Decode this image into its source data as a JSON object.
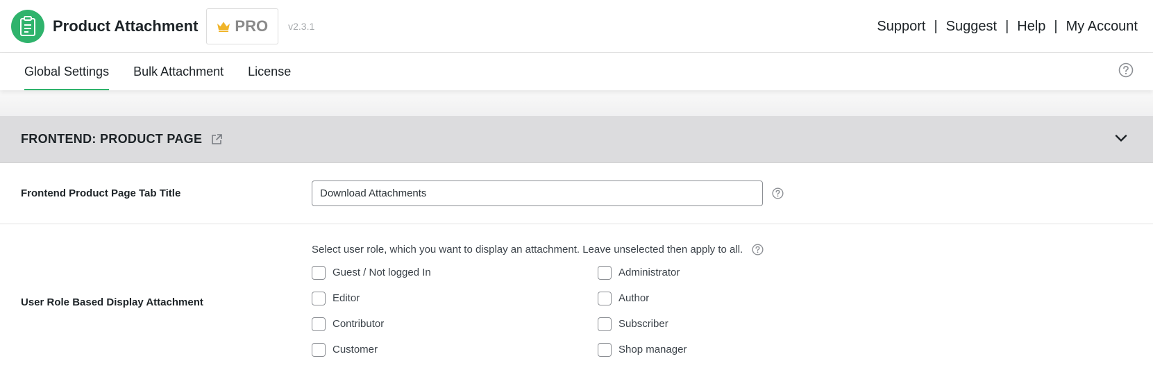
{
  "header": {
    "app_title": "Product Attachment",
    "pro_label": "PRO",
    "version": "v2.3.1",
    "links": [
      {
        "label": "Support"
      },
      {
        "label": "Suggest"
      },
      {
        "label": "Help"
      },
      {
        "label": "My Account"
      }
    ],
    "separator": "|"
  },
  "tabs": [
    {
      "label": "Global Settings",
      "active": true
    },
    {
      "label": "Bulk Attachment",
      "active": false
    },
    {
      "label": "License",
      "active": false
    }
  ],
  "section": {
    "title": "FRONTEND: PRODUCT PAGE"
  },
  "tab_title_setting": {
    "label": "Frontend Product Page Tab Title",
    "value": "Download Attachments"
  },
  "user_role_setting": {
    "label": "User Role Based Display Attachment",
    "description": "Select user role, which you want to display an attachment. Leave unselected then apply to all.",
    "roles": [
      {
        "label": "Guest / Not logged In",
        "checked": false
      },
      {
        "label": "Administrator",
        "checked": false
      },
      {
        "label": "Editor",
        "checked": false
      },
      {
        "label": "Author",
        "checked": false
      },
      {
        "label": "Contributor",
        "checked": false
      },
      {
        "label": "Subscriber",
        "checked": false
      },
      {
        "label": "Customer",
        "checked": false
      },
      {
        "label": "Shop manager",
        "checked": false
      }
    ]
  },
  "colors": {
    "brand_green": "#2fb36c",
    "crown_gold": "#f0b429",
    "section_gray": "#dcdcde"
  },
  "icons": {
    "logo": "document-clipboard-icon",
    "pro": "crown-icon",
    "help": "question-circle-icon",
    "external": "external-link-icon",
    "collapse": "chevron-down-icon"
  }
}
